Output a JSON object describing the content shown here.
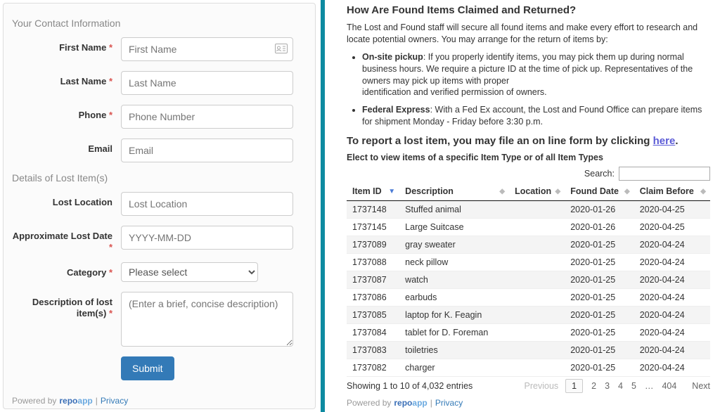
{
  "form": {
    "section_contact": "Your Contact Information",
    "first_name_label": "First Name",
    "first_name_ph": "First Name",
    "last_name_label": "Last Name",
    "last_name_ph": "Last Name",
    "phone_label": "Phone",
    "phone_ph": "Phone Number",
    "email_label": "Email",
    "email_ph": "Email",
    "section_details": "Details of Lost Item(s)",
    "lost_location_label": "Lost Location",
    "lost_location_ph": "Lost Location",
    "approx_date_label": "Approximate Lost Date",
    "approx_date_ph": "YYYY-MM-DD",
    "category_label": "Category",
    "category_option": "Please select",
    "description_label": "Description of lost item(s)",
    "description_ph": "(Enter a brief, concise description)",
    "submit": "Submit",
    "required_mark": "*"
  },
  "footer": {
    "powered": "Powered by",
    "brand_a": "repo",
    "brand_b": "app",
    "sep": "|",
    "privacy": "Privacy"
  },
  "info": {
    "heading": "How Are Found Items Claimed and Returned?",
    "intro": "The Lost and Found staff will secure all found items and make every effort to research and locate potential owners. You may arrange for the return of items by:",
    "b1_bold": "On-site pickup",
    "b1_text": ": If you properly identify items, you may pick them up during normal business hours. We require a picture ID at the time of pick up. Representatives of the owners may pick up items with proper",
    "b1_text2": "identification and verified permission of owners.",
    "b2_bold": "Federal Express",
    "b2_text": ": With a Fed Ex account, the Lost and Found Office can prepare items for shipment Monday - Friday before 3:30 p.m.",
    "report_a": "To report a lost item, you may file an on line form by clicking ",
    "report_link": "here",
    "report_b": ".",
    "elect": "Elect to view items of a specific Item Type or of all Item Types",
    "search_label": "Search:"
  },
  "table": {
    "cols": {
      "id": "Item ID",
      "desc": "Description",
      "loc": "Location",
      "found": "Found Date",
      "claim": "Claim Before"
    },
    "rows": [
      {
        "id": "1737148",
        "desc": "Stuffed animal",
        "loc": "",
        "found": "2020-01-26",
        "claim": "2020-04-25"
      },
      {
        "id": "1737145",
        "desc": "Large Suitcase",
        "loc": "",
        "found": "2020-01-26",
        "claim": "2020-04-25"
      },
      {
        "id": "1737089",
        "desc": "gray sweater",
        "loc": "",
        "found": "2020-01-25",
        "claim": "2020-04-24"
      },
      {
        "id": "1737088",
        "desc": "neck pillow",
        "loc": "",
        "found": "2020-01-25",
        "claim": "2020-04-24"
      },
      {
        "id": "1737087",
        "desc": "watch",
        "loc": "",
        "found": "2020-01-25",
        "claim": "2020-04-24"
      },
      {
        "id": "1737086",
        "desc": "earbuds",
        "loc": "",
        "found": "2020-01-25",
        "claim": "2020-04-24"
      },
      {
        "id": "1737085",
        "desc": "laptop for K. Feagin",
        "loc": "",
        "found": "2020-01-25",
        "claim": "2020-04-24"
      },
      {
        "id": "1737084",
        "desc": "tablet for D. Foreman",
        "loc": "",
        "found": "2020-01-25",
        "claim": "2020-04-24"
      },
      {
        "id": "1737083",
        "desc": "toiletries",
        "loc": "",
        "found": "2020-01-25",
        "claim": "2020-04-24"
      },
      {
        "id": "1737082",
        "desc": "charger",
        "loc": "",
        "found": "2020-01-25",
        "claim": "2020-04-24"
      }
    ],
    "showing": "Showing 1 to 10 of 4,032 entries",
    "prev": "Previous",
    "pages": [
      "1",
      "2",
      "3",
      "4",
      "5",
      "…",
      "404"
    ],
    "next": "Next"
  }
}
